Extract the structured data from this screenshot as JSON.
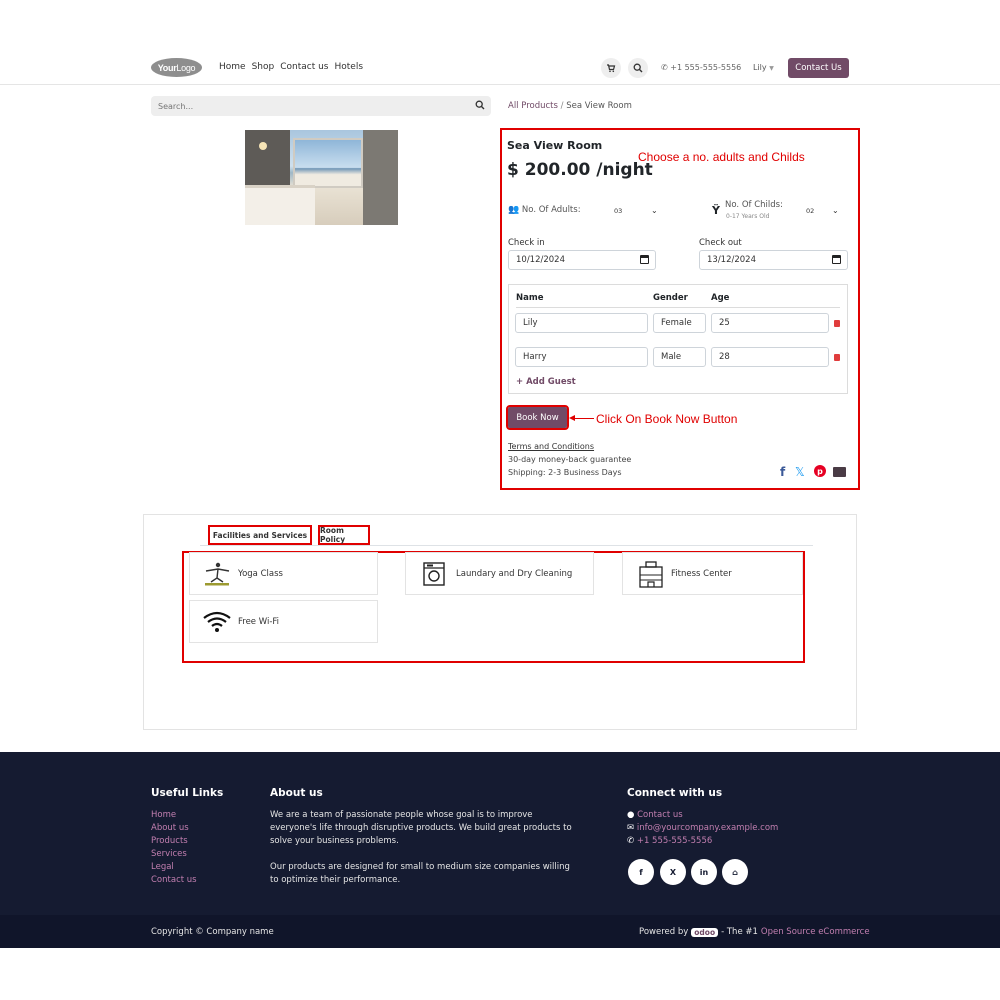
{
  "header": {
    "logo_text_bold": "Your",
    "logo_text_thin": "Logo",
    "nav": [
      "Home",
      "Shop",
      "Contact us",
      "Hotels"
    ],
    "phone": "+1 555-555-5556",
    "user": "Lily",
    "contact_button": "Contact Us"
  },
  "search": {
    "placeholder": "Search..."
  },
  "breadcrumb": {
    "parent": "All Products",
    "separator": "/",
    "current": "Sea View Room"
  },
  "booking": {
    "title": "Sea View Room",
    "price": "$ 200.00 /night",
    "adults_label": "No. Of Adults:",
    "adults_value": "03",
    "childs_label": "No. Of Childs:",
    "childs_sub": "0-17 Years Old",
    "childs_value": "02",
    "checkin_label": "Check in",
    "checkin_value": "10/12/2024",
    "checkout_label": "Check out",
    "checkout_value": "13/12/2024",
    "table_headers": {
      "name": "Name",
      "gender": "Gender",
      "age": "Age"
    },
    "guests": [
      {
        "name": "Lily",
        "gender": "Female",
        "age": "25"
      },
      {
        "name": "Harry",
        "gender": "Male",
        "age": "28"
      }
    ],
    "add_guest": "+ Add Guest",
    "book_button": "Book Now",
    "terms": "Terms and Conditions",
    "guarantee": "30-day money-back guarantee",
    "shipping": "Shipping: 2-3 Business Days",
    "share_icons": [
      "facebook-icon",
      "x-icon",
      "pinterest-icon",
      "envelope-icon"
    ]
  },
  "annotations": {
    "choose": "Choose a no. adults and Childs",
    "click": "Click On Book Now Button"
  },
  "tabs": [
    "Facilities and Services",
    "Room Policy"
  ],
  "facilities": [
    "Yoga Class",
    "Laundary and Dry Cleaning",
    "Fitness Center",
    "Free Wi-Fi"
  ],
  "footer": {
    "useful_links_title": "Useful Links",
    "links": [
      "Home",
      "About us",
      "Products",
      "Services",
      "Legal",
      "Contact us"
    ],
    "about_title": "About us",
    "about_p1_l1": "We are a team of passionate people whose goal is to improve",
    "about_p1_l2": "everyone's life through disruptive products. We build great products to",
    "about_p1_l3": "solve your business problems.",
    "about_p2_l1": "Our products are designed for small to medium size companies willing",
    "about_p2_l2": "to optimize their performance.",
    "connect_title": "Connect with us",
    "connect_contact": "Contact us",
    "connect_email": "info@yourcompany.example.com",
    "connect_phone": "+1 555-555-5556",
    "social_glyphs": [
      "f",
      "X",
      "in",
      "⌂"
    ],
    "copyright": "Copyright © Company name",
    "powered_by": "Powered by",
    "odoo": "odoo",
    "the_number_one": "- The #1",
    "open_source": "Open Source eCommerce"
  },
  "colors": {
    "brand": "#714b67",
    "annotation": "#e00000",
    "footer_bg": "#151b31"
  }
}
